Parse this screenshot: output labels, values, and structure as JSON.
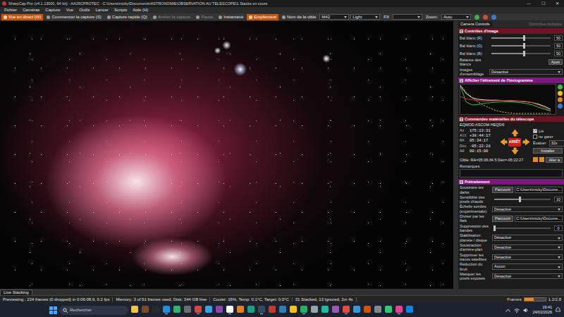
{
  "window": {
    "title": "SharpCap Pro (v4.1.13000, 64 bit) - AA26CPROTEC - C:\\Users\\micky\\Documents\\ASTRONOMIE\\OBSERVATION AU TELESCOPE\\1 Stacks en cours",
    "controls": [
      "—",
      "☐",
      "✕"
    ]
  },
  "menu": [
    "Fichier",
    "Caméras",
    "Capture",
    "Vue",
    "Outils",
    "Lancer",
    "Scripts",
    "Aide (H)"
  ],
  "toolbar": [
    {
      "kind": "button",
      "label": "Vue en direct (W)",
      "selected": true,
      "disabled": false
    },
    {
      "kind": "button",
      "label": "Commencer la capture (S)",
      "selected": false,
      "disabled": false
    },
    {
      "kind": "button",
      "label": "Capture rapide (Q)",
      "selected": false,
      "disabled": false
    },
    {
      "kind": "button",
      "label": "Arrêter la capture",
      "selected": false,
      "disabled": true
    },
    {
      "kind": "button",
      "label": "Pause",
      "selected": false,
      "disabled": true
    },
    {
      "kind": "button",
      "label": "Instantané",
      "selected": false,
      "disabled": false
    },
    {
      "kind": "button",
      "label": "Empilement",
      "selected": true,
      "disabled": false
    },
    {
      "kind": "button",
      "label": "Nom de la cible",
      "selected": false,
      "disabled": false
    },
    {
      "kind": "select",
      "label": "M42",
      "selected": false,
      "disabled": false
    },
    {
      "kind": "select",
      "label": "Light",
      "selected": false,
      "disabled": false
    },
    {
      "kind": "text",
      "label": "FX",
      "selected": false,
      "disabled": false
    },
    {
      "kind": "select",
      "label": "",
      "selected": false,
      "disabled": false
    },
    {
      "kind": "text",
      "label": "Zoom:",
      "selected": false,
      "disabled": false
    },
    {
      "kind": "select",
      "label": "Auto",
      "selected": false,
      "disabled": false
    }
  ],
  "panel": {
    "tabs": [
      {
        "label": "Camera Controls",
        "selected": true
      },
      {
        "label": "Contrôles multiples",
        "selected": false
      }
    ],
    "image_controls": {
      "title": "Contrôles d'image",
      "rows": [
        {
          "kind": "slider",
          "label": "Bal blanc (R)",
          "level": 0.55,
          "value": "50"
        },
        {
          "kind": "slider",
          "label": "Bal blanc (G)",
          "level": 0.55,
          "value": "50"
        },
        {
          "kind": "slider",
          "label": "Bal blanc (B)",
          "level": 0.55,
          "value": "50"
        },
        {
          "kind": "button",
          "label": "Balance des blancs",
          "value": "Ajust"
        },
        {
          "kind": "select",
          "label": "Images d'ensemblage",
          "value": "Désactivé"
        }
      ]
    },
    "histogram": {
      "title": "Afficher l'étirement de l'histogramme",
      "series": [
        {
          "kind": "dashed",
          "color": "#e8d21a",
          "values": [
            100,
            75,
            55,
            40,
            28,
            18,
            10,
            5,
            2,
            0,
            0,
            0,
            0,
            0,
            0,
            0
          ]
        },
        {
          "kind": "solid",
          "color": "#e8e8e8",
          "values": [
            98,
            70,
            55,
            50,
            48,
            47,
            47,
            46,
            45,
            44,
            43,
            41,
            38,
            33,
            25,
            15
          ]
        },
        {
          "kind": "solid",
          "color": "#3fbf3f",
          "values": [
            95,
            40,
            30,
            32,
            36,
            38,
            40,
            41,
            41,
            40,
            38,
            35,
            30,
            22,
            15,
            8
          ]
        },
        {
          "kind": "solid",
          "color": "#e03030",
          "values": [
            60,
            52,
            48,
            45,
            44,
            44,
            45,
            46,
            46,
            45,
            44,
            42,
            38,
            30,
            20,
            10
          ]
        }
      ]
    },
    "telescope": {
      "title": "Commandes matérielles du télescope",
      "mount": "EQMOD ASCOM HEQ5/6",
      "readouts": [
        {
          "label": "Az",
          "value": "175:13:31"
        },
        {
          "label": "Alt",
          "value": "+38:44:17"
        },
        {
          "label": "RA",
          "value": "05:34:17"
        },
        {
          "label": "Déc",
          "value": "-05:22:28"
        },
        {
          "label": "AH",
          "value": "00:15:00"
        }
      ],
      "stop": "ARRÊT",
      "checks": [
        {
          "label": "Lié",
          "checked": true
        },
        {
          "label": "ne garer",
          "checked": false
        }
      ],
      "rate_label": "Évaluer",
      "rate": "32x",
      "install": "Installer",
      "target": "Cible: RA=05:36:34.5 Déc=-05:22:27",
      "goto": "Aller à"
    },
    "notes": {
      "label": "Remarques",
      "value": ""
    },
    "preprocessing": {
      "title": "Prétraitement",
      "rows": [
        {
          "kind": "browse",
          "label": "Soustraire les darks",
          "button": "Parcourir",
          "value": "C:\\Users\\micky\\Docume..."
        },
        {
          "kind": "slider",
          "label": "Sensibilité des pixels chauds",
          "level": 0.45,
          "value": "10"
        },
        {
          "kind": "select",
          "label": "Échelle sombre (expérimentale)",
          "value": "Désactivé"
        },
        {
          "kind": "browse",
          "label": "Diviser par les flats",
          "button": "Parcourir",
          "value": "C:\\Users\\micky\\Docume..."
        },
        {
          "kind": "slider",
          "label": "Suppression des bandes",
          "level": 0.0,
          "value": "0"
        },
        {
          "kind": "select",
          "label": "Stabilisation planète / disque",
          "value": "Désactivé"
        },
        {
          "kind": "select",
          "label": "Soustraction d'arrière-plan",
          "value": "Désactivé"
        },
        {
          "kind": "select",
          "label": "Supprimer les traces satellites",
          "value": "Désactivé"
        },
        {
          "kind": "select",
          "label": "Réduction du bruit",
          "value": "Aucun"
        },
        {
          "kind": "select",
          "label": "Masquer les pixels exposés",
          "value": "Désactivé"
        }
      ]
    }
  },
  "status": {
    "tab": "Live Stacking",
    "segments": [
      "Previewing : 224 frames (0 dropped) in 0:06:08.9, 0.2 fps",
      "Memory: 3 of 51 frames used, Disk: 344 GB free",
      "Cooler: 16%, Temp: 0.1°C, Target: 0.0°C",
      "31 Stacked, 13 Ignored, 2m 4s"
    ],
    "frames": {
      "label": "Frames",
      "level": 0.43,
      "reading": "1.2/2.8"
    }
  },
  "taskbar": {
    "search": {
      "placeholder": "Rechercher"
    },
    "apps": [
      {
        "color": "#f3c542",
        "running": false
      },
      {
        "color": "#7a4b2a",
        "running": false
      },
      {
        "color": "#2a2a2a",
        "running": false
      },
      {
        "color": "#1f8fe0",
        "running": true
      },
      {
        "color": "#2fb56a",
        "running": false
      },
      {
        "color": "#6d6d6d",
        "running": false
      },
      {
        "color": "#d64541",
        "running": true
      },
      {
        "color": "#3aa0e8",
        "running": false
      },
      {
        "color": "#8e44ad",
        "running": false
      },
      {
        "color": "#ffffff",
        "running": true
      },
      {
        "color": "#e67e22",
        "running": false
      },
      {
        "color": "#16a085",
        "running": false
      },
      {
        "color": "#34495e",
        "running": true
      },
      {
        "color": "#c0392b",
        "running": false
      },
      {
        "color": "#2980b9",
        "running": false
      },
      {
        "color": "#f1c40f",
        "running": false
      },
      {
        "color": "#27ae60",
        "running": true
      },
      {
        "color": "#95a5a6",
        "running": false
      },
      {
        "color": "#1abc9c",
        "running": false
      },
      {
        "color": "#9b59b6",
        "running": false
      },
      {
        "color": "#e74c3c",
        "running": true
      },
      {
        "color": "#3498db",
        "running": false
      },
      {
        "color": "#d35400",
        "running": false
      },
      {
        "color": "#7f8c8d",
        "running": false
      },
      {
        "color": "#2ecc71",
        "running": false
      },
      {
        "color": "#e84393",
        "running": true
      },
      {
        "color": "#0984e3",
        "running": false
      }
    ],
    "time": "19:41",
    "date": "24/02/2026"
  }
}
